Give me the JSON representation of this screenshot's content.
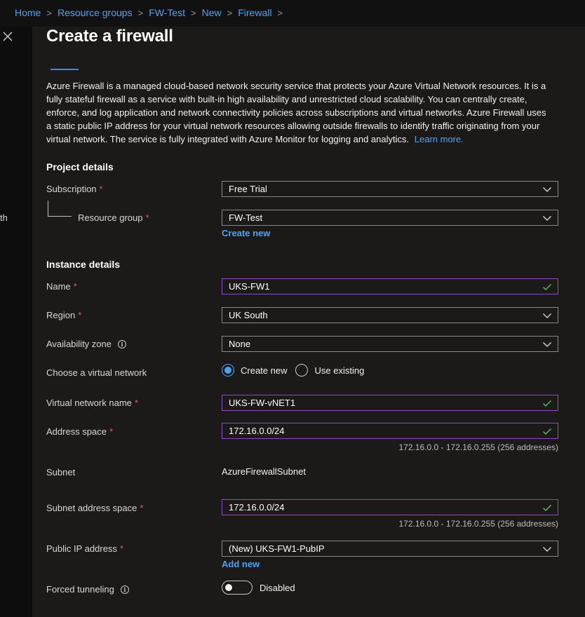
{
  "breadcrumb": {
    "items": [
      "Home",
      "Resource groups",
      "FW-Test",
      "New",
      "Firewall"
    ],
    "separator": ">"
  },
  "edge_text": "th",
  "blade": {
    "title": "Create a firewall",
    "description": "Azure Firewall is a managed cloud-based network security service that protects your Azure Virtual Network resources. It is a fully stateful firewall as a service with built-in high availability and unrestricted cloud scalability. You can centrally create, enforce, and log application and network connectivity policies across subscriptions and virtual networks. Azure Firewall uses a static public IP address for your virtual network resources allowing outside firewalls to identify traffic originating from your virtual network. The service is fully integrated with Azure Monitor for logging and analytics.",
    "learn_more": "Learn more."
  },
  "project_details": {
    "title": "Project details",
    "subscription": {
      "label": "Subscription",
      "required": "*",
      "value": "Free Trial"
    },
    "resource_group": {
      "label": "Resource group",
      "required": "*",
      "value": "FW-Test",
      "create_new": "Create new"
    }
  },
  "instance_details": {
    "title": "Instance details",
    "name": {
      "label": "Name",
      "required": "*",
      "value": "UKS-FW1"
    },
    "region": {
      "label": "Region",
      "required": "*",
      "value": "UK South"
    },
    "availability_zone": {
      "label": "Availability zone",
      "info": "i",
      "value": "None"
    },
    "virtual_network": {
      "label": "Choose a virtual network",
      "options": [
        "Create new",
        "Use existing"
      ],
      "selected": "Create new"
    },
    "vnet_name": {
      "label": "Virtual network name",
      "required": "*",
      "value": "UKS-FW-vNET1"
    },
    "address_space": {
      "label": "Address space",
      "required": "*",
      "value": "172.16.0.0/24",
      "hint": "172.16.0.0 - 172.16.0.255 (256 addresses)"
    },
    "subnet": {
      "label": "Subnet",
      "value": "AzureFirewallSubnet"
    },
    "subnet_address_space": {
      "label": "Subnet address space",
      "required": "*",
      "value": "172.16.0.0/24",
      "hint": "172.16.0.0 - 172.16.0.255 (256 addresses)"
    },
    "public_ip": {
      "label": "Public IP address",
      "required": "*",
      "value": "(New) UKS-FW1-PubIP",
      "add_new": "Add new"
    },
    "forced_tunneling": {
      "label": "Forced tunneling",
      "info": "i",
      "state": "Disabled"
    }
  },
  "colors": {
    "accent": "#4ba3f5",
    "required": "#e05b5b",
    "valid_border": "#8a4bc9",
    "valid_check": "#57c45a",
    "background": "#1b1a19"
  },
  "icons": {
    "close": "close-icon",
    "dropdown": "chevron-down-icon",
    "valid": "checkmark-icon",
    "info": "info-icon"
  }
}
